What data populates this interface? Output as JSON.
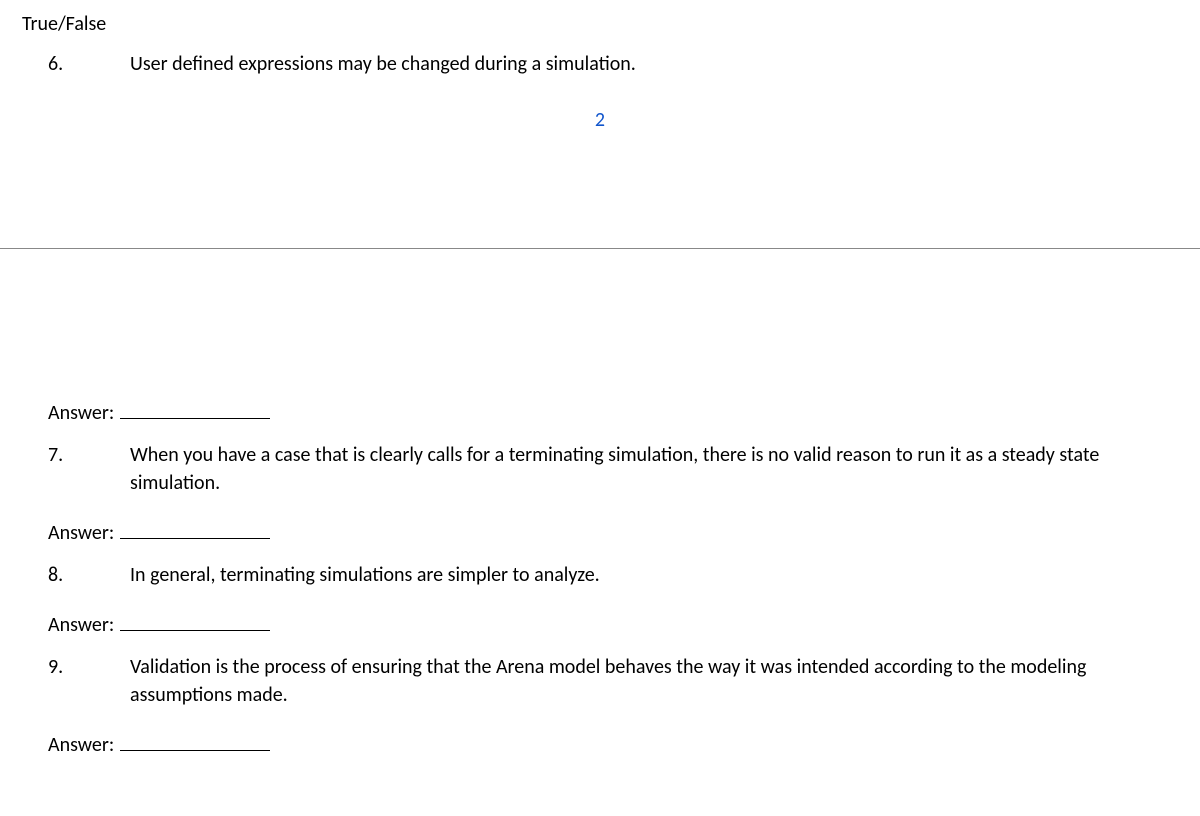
{
  "section_header": "True/False",
  "page_number": "2",
  "answer_label": "Answer:",
  "questions": [
    {
      "number": "6.",
      "text": "User defined expressions may be changed during a simulation."
    },
    {
      "number": "7.",
      "text": "When you have a case that is clearly calls for a terminating simulation, there is no valid reason to run it as a steady state simulation."
    },
    {
      "number": "8.",
      "text": "In general, terminating simulations are simpler to analyze."
    },
    {
      "number": "9.",
      "text": "Validation is the process of ensuring that the Arena model behaves the way it was intended according to the modeling assumptions made."
    }
  ]
}
